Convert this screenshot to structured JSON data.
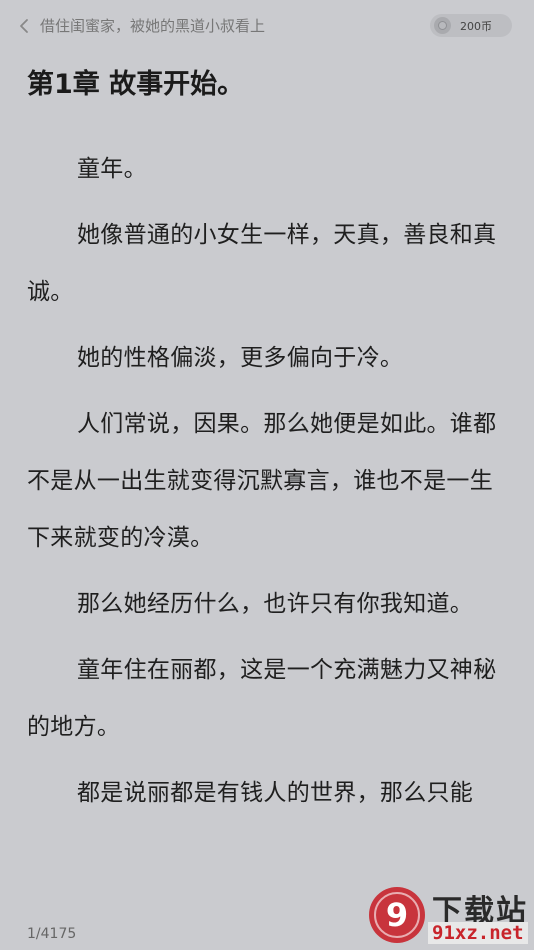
{
  "header": {
    "book_title": "借住闺蜜家，被她的黑道小叔看上",
    "coins": "200币"
  },
  "chapter": {
    "title": "第1章 故事开始。",
    "paragraphs": [
      "童年。",
      "她像普通的小女生一样，天真，善良和真诚。",
      "她的性格偏淡，更多偏向于冷。",
      "人们常说，因果。那么她便是如此。谁都不是从一出生就变得沉默寡言，谁也不是一生下来就变的冷漠。",
      "那么她经历什么，也许只有你我知道。",
      "童年住在丽都，这是一个充满魅力又神秘的地方。",
      "都是说丽都是有钱人的世界，那么只能"
    ]
  },
  "footer": {
    "page_indicator": "1/4175"
  },
  "watermark": {
    "logo_text": "9",
    "title": "下载站",
    "url": "91xz.net",
    "colors": {
      "brand_red": "#c8242b"
    }
  },
  "colors": {
    "background": "#cacbcf",
    "text": "#1f1f1f"
  }
}
